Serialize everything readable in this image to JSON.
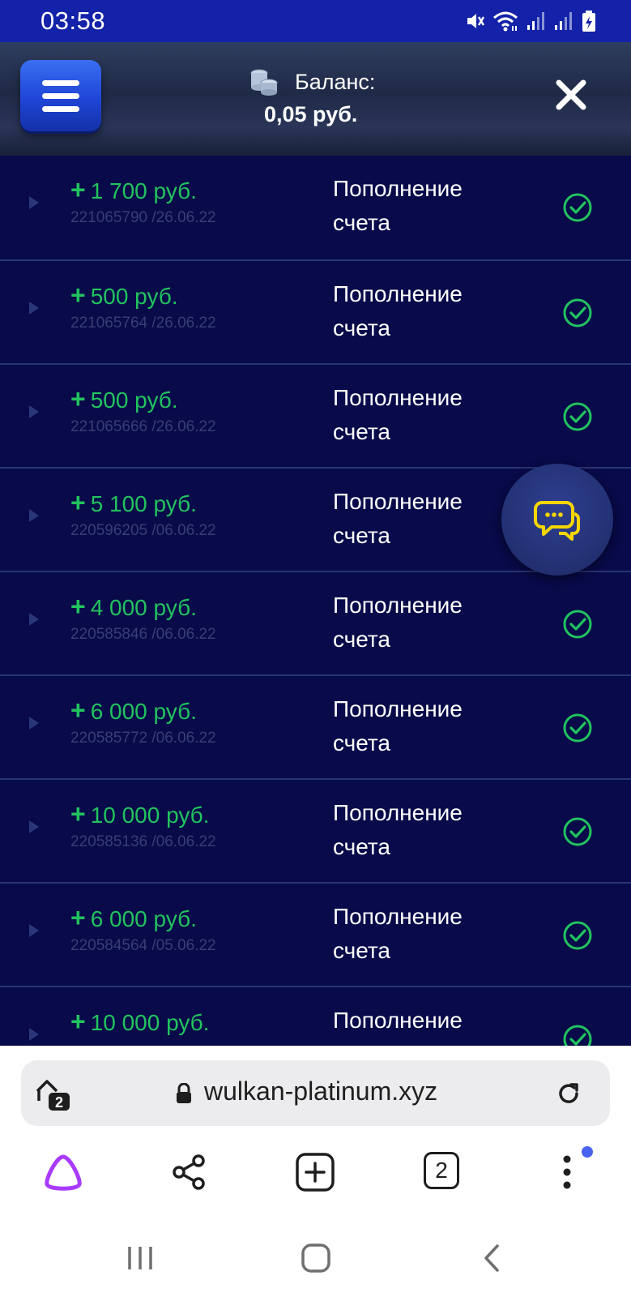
{
  "status_bar": {
    "time": "03:58",
    "icons": [
      "mute-icon",
      "wifi-icon",
      "signal-icon",
      "signal-icon",
      "battery-charging-icon"
    ]
  },
  "header": {
    "menu_icon": "hamburger-icon",
    "coins_icon": "coins-icon",
    "balance_label": "Баланс:",
    "balance_value": "0,05 руб.",
    "close_icon": "close-icon"
  },
  "transactions": [
    {
      "amount": "1 700 руб.",
      "meta": "221065790 /26.06.22",
      "type": "Пополнение счета",
      "status": "check-circle-icon"
    },
    {
      "amount": "500 руб.",
      "meta": "221065764 /26.06.22",
      "type": "Пополнение счета",
      "status": "check-circle-icon"
    },
    {
      "amount": "500 руб.",
      "meta": "221065666 /26.06.22",
      "type": "Пополнение счета",
      "status": "check-circle-icon"
    },
    {
      "amount": "5 100 руб.",
      "meta": "220596205 /06.06.22",
      "type": "Пополнение счета",
      "status": "check-circle-icon"
    },
    {
      "amount": "4 000 руб.",
      "meta": "220585846 /06.06.22",
      "type": "Пополнение счета",
      "status": "check-circle-icon"
    },
    {
      "amount": "6 000 руб.",
      "meta": "220585772 /06.06.22",
      "type": "Пополнение счета",
      "status": "check-circle-icon"
    },
    {
      "amount": "10 000 руб.",
      "meta": "220585136 /06.06.22",
      "type": "Пополнение счета",
      "status": "check-circle-icon"
    },
    {
      "amount": "6 000 руб.",
      "meta": "220584564 /05.06.22",
      "type": "Пополнение счета",
      "status": "check-circle-icon"
    },
    {
      "amount": "10 000 руб.",
      "meta": "",
      "type": "Пополнение счета",
      "status": "check-circle-icon"
    }
  ],
  "chat_button": {
    "icon": "chat-bubbles-icon"
  },
  "browser": {
    "tabs_badge": "2",
    "url": "wulkan-platinum.xyz",
    "toolbar": {
      "tab_count": "2"
    }
  },
  "colors": {
    "status_bar": "#1322a8",
    "list_bg": "#080a4a",
    "amount_green": "#22c35e",
    "chat_yellow": "#f5d600",
    "alice_purple": "#a93bff"
  }
}
